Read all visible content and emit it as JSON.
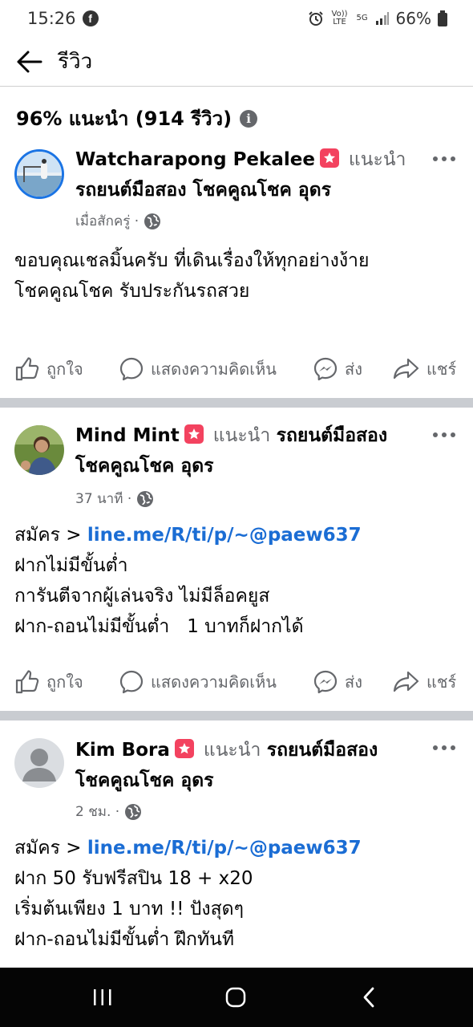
{
  "status_bar": {
    "time": "15:26",
    "volte": "Vo)) LTE",
    "network": "5G",
    "battery": "66%"
  },
  "header": {
    "title": "รีวิว"
  },
  "summary": {
    "text": "96% แนะนำ (914 รีวิว)"
  },
  "actions": {
    "like": "ถูกใจ",
    "comment": "แสดงความคิดเห็น",
    "send": "ส่ง",
    "share": "แชร์"
  },
  "reviews": [
    {
      "author": "Watcharapong Pekalee",
      "recommends": "แนะนำ",
      "page": "รถยนต์มือสอง โชคคูณโชค อุดร",
      "time": "เมื่อสักครู่ ·",
      "lines": [
        "ขอบคุณเชลมิ้นครับ ที่เดินเรื่องให้ทุกอย่างง้าย",
        "โชคคูณโชค รับประกันรถสวย"
      ]
    },
    {
      "author": "Mind Mint",
      "recommends": "แนะนำ",
      "page_part1": "รถยนต์มือสอง",
      "page_part2": "โชคคูณโชค อุดร",
      "time": "37 นาที ·",
      "prefix": "สมัคร >",
      "link": "line.me/R/ti/p/~@paew637",
      "lines": [
        "ฝากไม่มีขั้นต่ำ",
        "การันตีจากผู้เล่นจริง ไม่มีล็อคยูส",
        "ฝาก-ถอนไม่มีขั้นต่ำ   1 บาทก็ฝากได้"
      ]
    },
    {
      "author": "Kim Bora",
      "recommends": "แนะนำ",
      "page_part1": "รถยนต์มือสอง",
      "page_part2": "โชคคูณโชค อุดร",
      "time": "2 ชม. ·",
      "prefix": "สมัคร >",
      "link": "line.me/R/ti/p/~@paew637",
      "lines": [
        "ฝาก 50 รับฟรีสปิน 18 + x20",
        "เริ่มต้นเพียง 1 บาท !! ปังสุดๆ",
        "ฝาก-ถอนไม่มีขั้นต่ำ ฝึกทันที"
      ]
    }
  ],
  "colors": {
    "link": "#1b6dd4",
    "recommend_badge": "#f3425f",
    "secondary_text": "#65676b",
    "divider": "#c9ccd1"
  }
}
